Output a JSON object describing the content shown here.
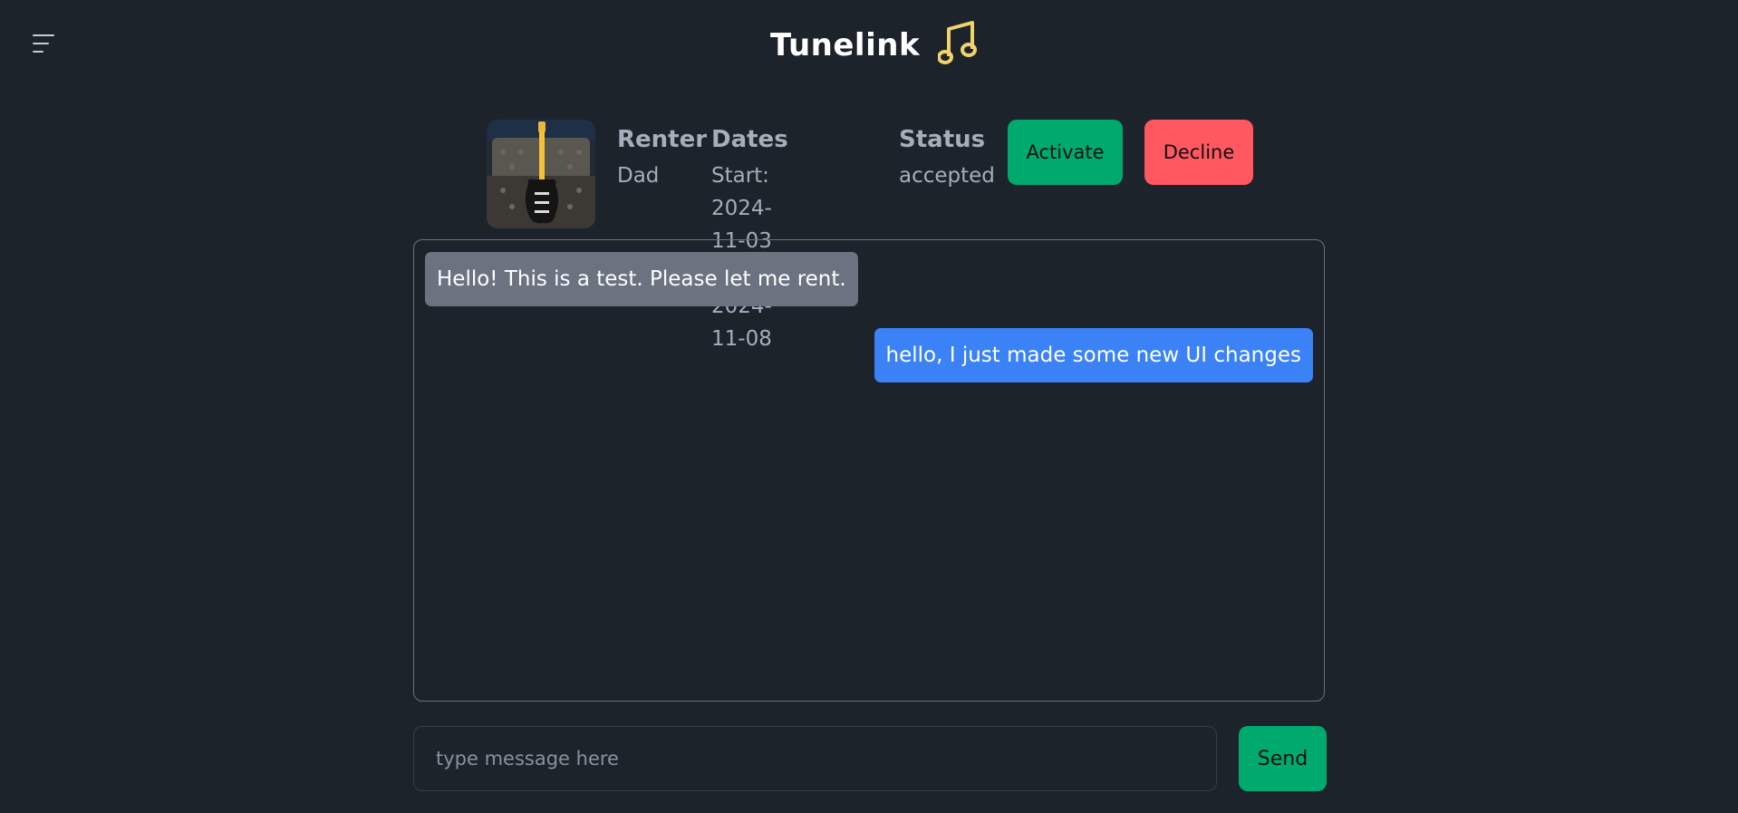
{
  "app": {
    "title": "Tunelink",
    "logo_icon": "music-note-icon",
    "menu_icon": "hamburger-menu-icon",
    "accent_color": "#f0d36a"
  },
  "rental": {
    "image_alt": "guitar-photo",
    "renter_heading": "Renter",
    "renter_name": "Dad",
    "dates_heading": "Dates",
    "start_label": "Start: 2024-11-03",
    "end_label": "End: 2024-11-08",
    "status_heading": "Status",
    "status_value": "accepted"
  },
  "actions": {
    "activate_label": "Activate",
    "activate_color": "#00a96e",
    "decline_label": "Decline",
    "decline_color": "#ff5861"
  },
  "chat": {
    "messages": [
      {
        "direction": "incoming",
        "text": "Hello! This is a test. Please let me rent.",
        "color": "#6b7280"
      },
      {
        "direction": "outgoing",
        "text": "hello, I just made some new UI changes",
        "color": "#3b82f6"
      }
    ]
  },
  "composer": {
    "placeholder": "type message here",
    "value": "",
    "send_label": "Send",
    "send_color": "#00a96e"
  }
}
